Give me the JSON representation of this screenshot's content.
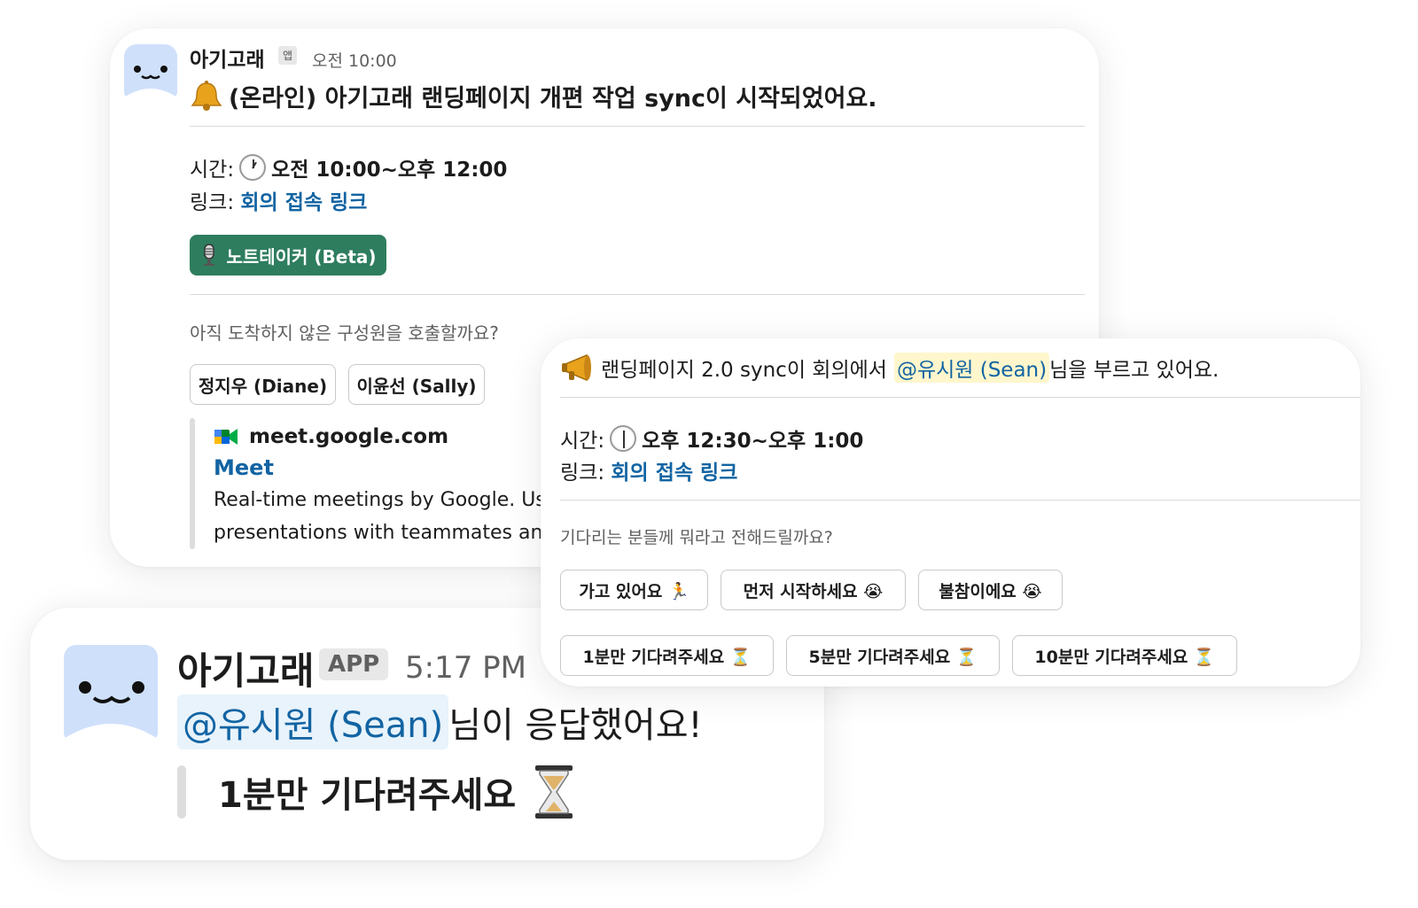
{
  "card1": {
    "bot_name": "아기고래",
    "badge": "앱",
    "time": "오전 10:00",
    "headline": "(온라인) 아기고래 랜딩페이지 개편 작업 sync이 시작되었어요.",
    "time_label": "시간:",
    "time_value": "오전 10:00~오후 12:00",
    "link_label": "링크:",
    "link_text": "회의 접속 링크",
    "notetaker_button": "노트테이커 (Beta)",
    "call_prompt": "아직 도착하지 않은 구성원을 호출할까요?",
    "member_buttons": [
      "정지우 (Diane)",
      "이윤선 (Sally)"
    ],
    "preview": {
      "domain": "meet.google.com",
      "title": "Meet",
      "desc_line1": "Real-time meetings by Google. Us",
      "desc_line2": "presentations with teammates an"
    }
  },
  "card2": {
    "prefix": "랜딩페이지 2.0 sync이 회의에서",
    "mention": "@유시원 (Sean)",
    "suffix": "님을 부르고 있어요.",
    "time_label": "시간:",
    "time_value": "오후 12:30~오후 1:00",
    "link_label": "링크:",
    "link_text": "회의 접속 링크",
    "prompt": "기다리는 분들께 뭐라고 전해드릴까요?",
    "row1": [
      "가고 있어요 🏃",
      "먼저 시작하세요 😭",
      "불참이에요 😭"
    ],
    "row2": [
      "1분만 기다려주세요 ⏳",
      "5분만 기다려주세요 ⏳",
      "10분만 기다려주세요 ⏳"
    ]
  },
  "card3": {
    "bot_name": "아기고래",
    "badge": "APP",
    "time": "5:17 PM",
    "mention": "@유시원 (Sean)",
    "suffix": "님이 응답했어요!",
    "quote": "1분만 기다려주세요"
  },
  "icons": {
    "bell": "bell-icon",
    "clock": "clock-icon",
    "microphone": "microphone-icon",
    "meet": "google-meet-icon",
    "megaphone": "megaphone-icon",
    "hourglass": "hourglass-icon"
  },
  "colors": {
    "link": "#1264a3",
    "notetaker_bg": "#2e7d5f",
    "mention_bg": "#fff6cc",
    "avatar_bg": "#cfe0fb"
  }
}
